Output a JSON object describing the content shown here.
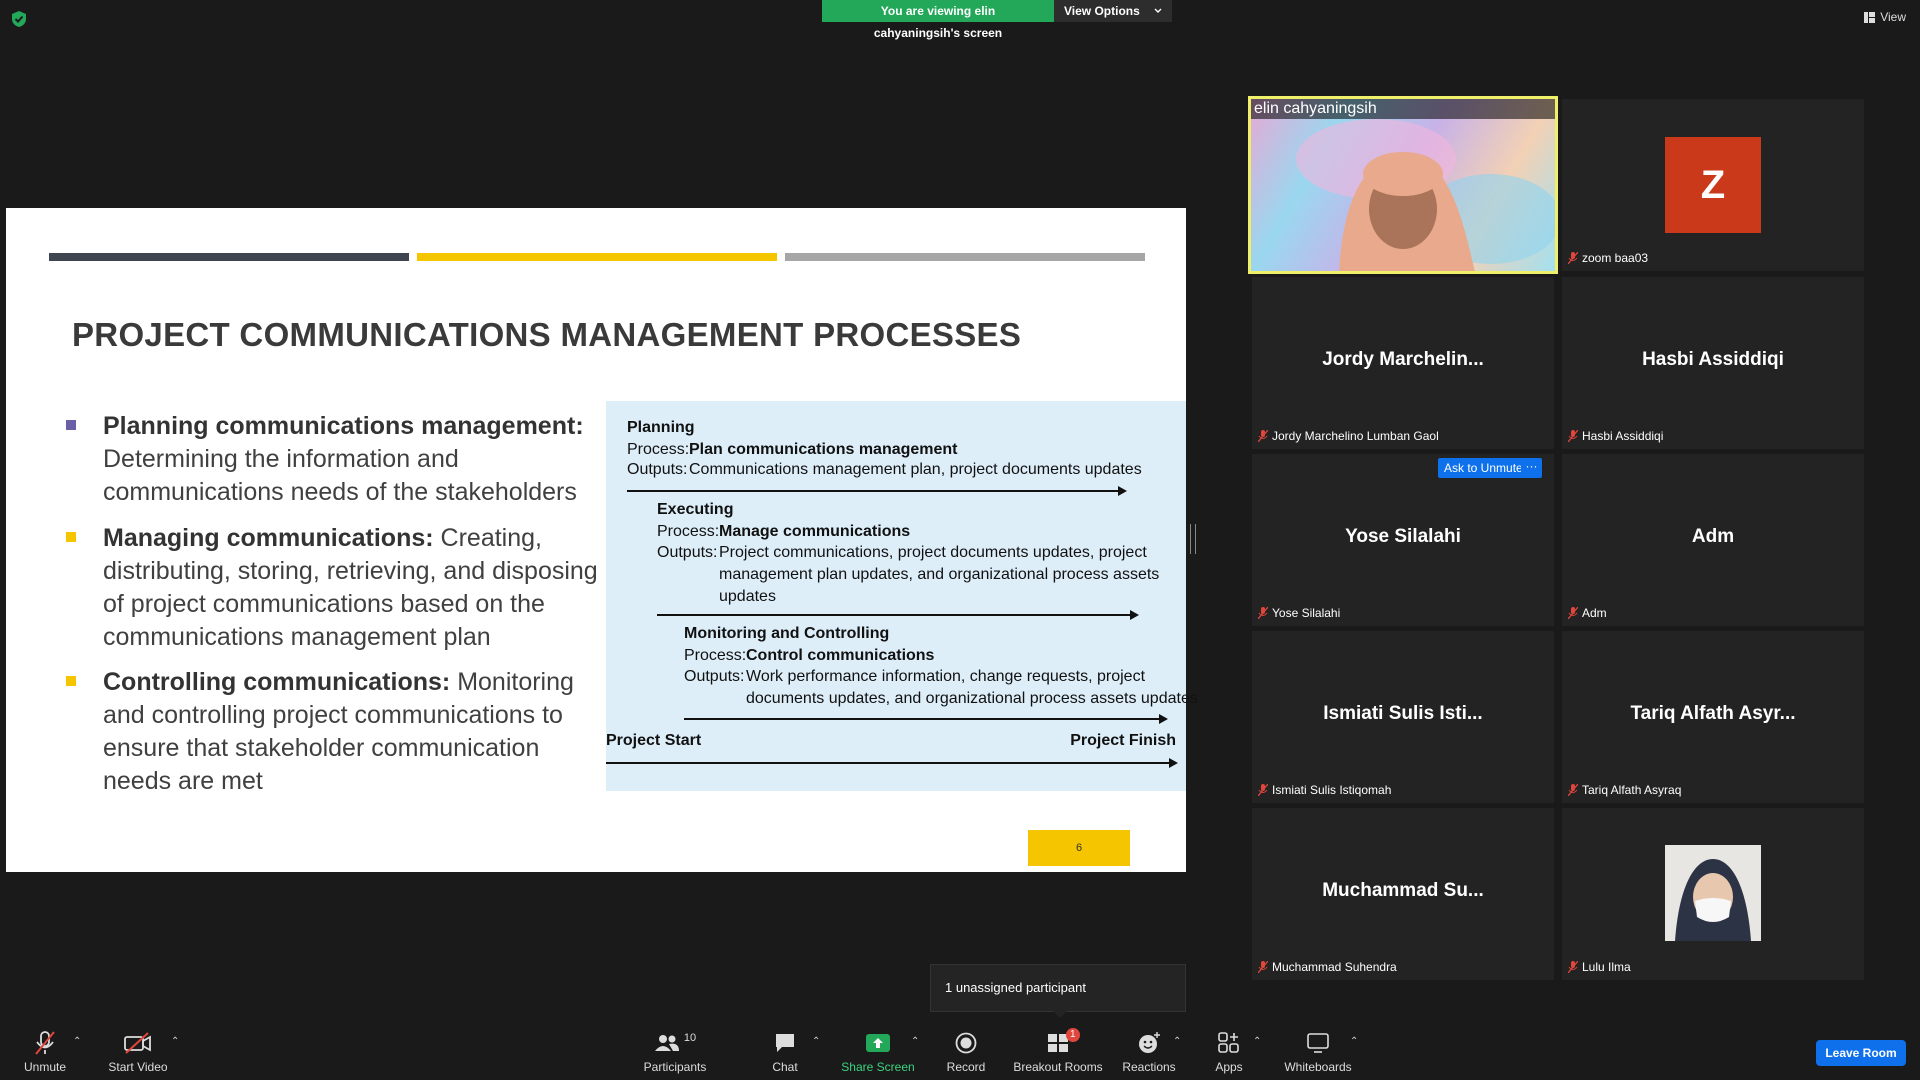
{
  "top": {
    "banner_text": "You are viewing elin cahyaningsih's screen",
    "view_options_label": "View Options",
    "view_label": "View"
  },
  "slide": {
    "title": "PROJECT COMMUNICATIONS MANAGEMENT PROCESSES",
    "bar_colors": [
      "#3f4651",
      "#f5c500",
      "#a6a6a6"
    ],
    "bullets": [
      {
        "term": "Planning communications management",
        "sep": ":",
        "text": "Determining the information and communications needs of the stakeholders",
        "color": "#6b5fa8"
      },
      {
        "term": "Managing communications:",
        "sep": "",
        "text": "Creating, distributing, storing, retrieving, and disposing of project communications based on the communications management plan",
        "color": "#f5c500"
      },
      {
        "term": "Controlling communications",
        "sep": ":",
        "text": "Monitoring and controlling project communications to ensure that stakeholder communication needs are met",
        "color": "#f5c500"
      }
    ],
    "diagram": {
      "planning_title": "Planning",
      "planning_process_label": "Process:",
      "planning_process": "Plan communications management",
      "planning_outputs_label": "Outputs:",
      "planning_outputs": "Communications management plan, project documents updates",
      "executing_title": "Executing",
      "executing_process_label": "Process:",
      "executing_process": "Manage communications",
      "executing_outputs_label": "Outputs:",
      "executing_outputs_1": "Project communications, project documents updates, project",
      "executing_outputs_2": "management plan updates, and organizational process assets",
      "executing_outputs_3": "updates",
      "monitoring_title": "Monitoring and Controlling",
      "monitoring_process_label": "Process:",
      "monitoring_process": "Control communications",
      "monitoring_outputs_label": "Outputs:",
      "monitoring_outputs_1": "Work performance information, change requests, project",
      "monitoring_outputs_2": "documents updates, and organizational process assets updates",
      "project_start": "Project Start",
      "project_finish": "Project Finish"
    },
    "page_number": "6"
  },
  "participants": [
    {
      "display": "",
      "label": "elin cahyaningsih"
    },
    {
      "display": "Z",
      "label": "zoom baa03"
    },
    {
      "display": "Jordy  Marchelin...",
      "label": "Jordy Marchelino Lumban Gaol"
    },
    {
      "display": "Hasbi Assiddiqi",
      "label": "Hasbi Assiddiqi"
    },
    {
      "display": "Yose Silalahi",
      "label": "Yose Silalahi"
    },
    {
      "display": "Adm",
      "label": "Adm"
    },
    {
      "display": "Ismiati Sulis Isti...",
      "label": "Ismiati Sulis Istiqomah"
    },
    {
      "display": "Tariq Alfath Asyr...",
      "label": "Tariq Alfath Asyraq"
    },
    {
      "display": "Muchammad  Su...",
      "label": "Muchammad Suhendra"
    },
    {
      "display": "",
      "label": "Lulu Ilma"
    }
  ],
  "ask_to_unmute": "Ask to Unmute",
  "more_label": "···",
  "tooltip": "1 unassigned participant",
  "toolbar": {
    "unmute": "Unmute",
    "start_video": "Start Video",
    "participants": "Participants",
    "participants_count": "10",
    "chat": "Chat",
    "share_screen": "Share Screen",
    "record": "Record",
    "breakout_rooms": "Breakout Rooms",
    "breakout_badge": "1",
    "reactions": "Reactions",
    "apps": "Apps",
    "whiteboards": "Whiteboards",
    "leave_room": "Leave Room"
  },
  "colors": {
    "share_green": "#23a85a",
    "accent_blue": "#0e71eb",
    "speaker_border": "#f0ef6a",
    "avatar_z": "#c9391a",
    "muted_red": "#e0463c"
  }
}
